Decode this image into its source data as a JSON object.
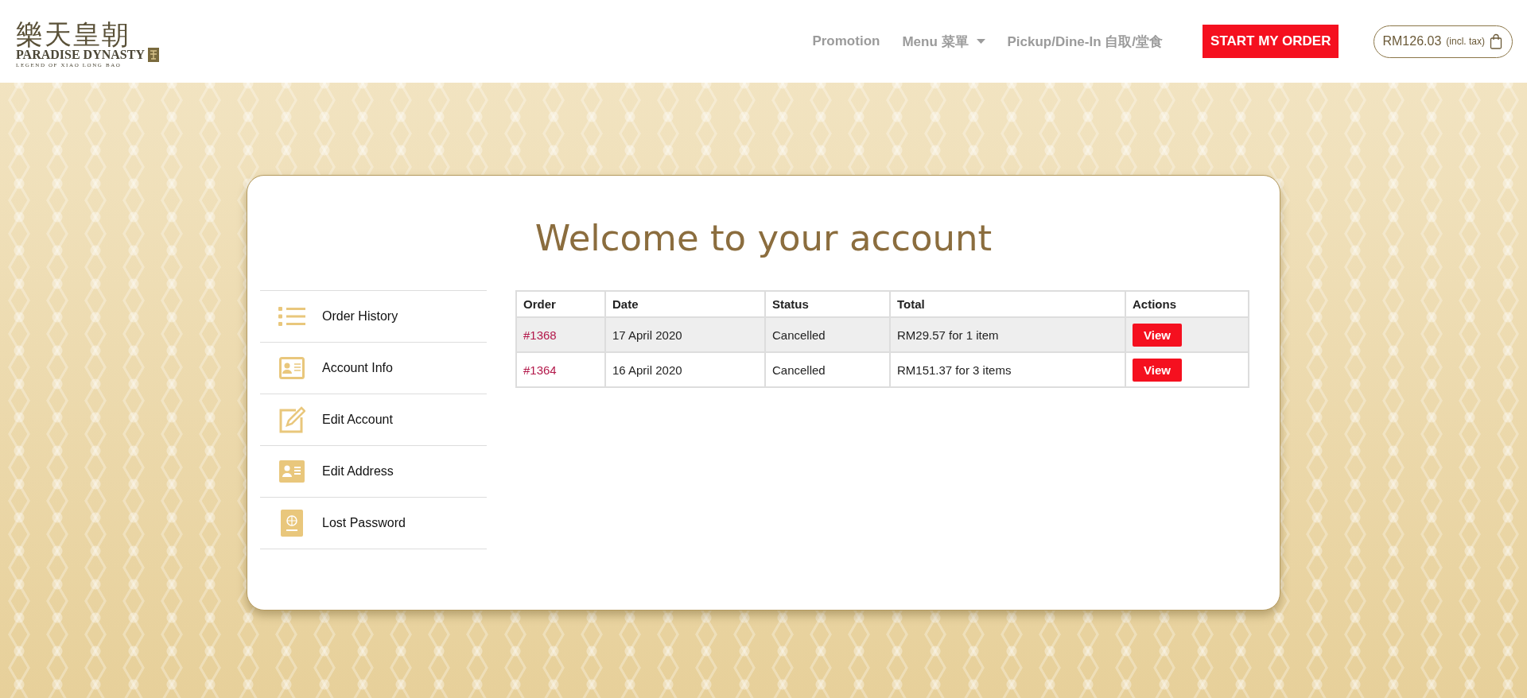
{
  "logo": {
    "chinese": "樂天皇朝",
    "name": "PARADISE DYNASTY",
    "tagline": "LEGEND OF XIAO LONG BAO"
  },
  "nav": [
    {
      "label": "Promotion",
      "dropdown": false
    },
    {
      "label": "Menu 菜單",
      "dropdown": true
    },
    {
      "label": "Pickup/Dine-In 自取/堂食",
      "dropdown": false
    }
  ],
  "order_button": "START MY ORDER",
  "cart": {
    "amount": "RM126.03",
    "note": "(incl. tax)"
  },
  "title": "Welcome to your account",
  "sidebar": {
    "items": [
      {
        "label": "Order History"
      },
      {
        "label": "Account Info"
      },
      {
        "label": "Edit Account"
      },
      {
        "label": "Edit Address"
      },
      {
        "label": "Lost Password"
      }
    ]
  },
  "table": {
    "columns": [
      "Order",
      "Date",
      "Status",
      "Total",
      "Actions"
    ],
    "rows": [
      {
        "order": "#1368",
        "date": "17 April 2020",
        "status": "Cancelled",
        "total": "RM29.57 for 1 item",
        "action": "View",
        "highlighted": true
      },
      {
        "order": "#1364",
        "date": "16 April 2020",
        "status": "Cancelled",
        "total": "RM151.37 for 3 items",
        "action": "View",
        "highlighted": false
      }
    ]
  }
}
